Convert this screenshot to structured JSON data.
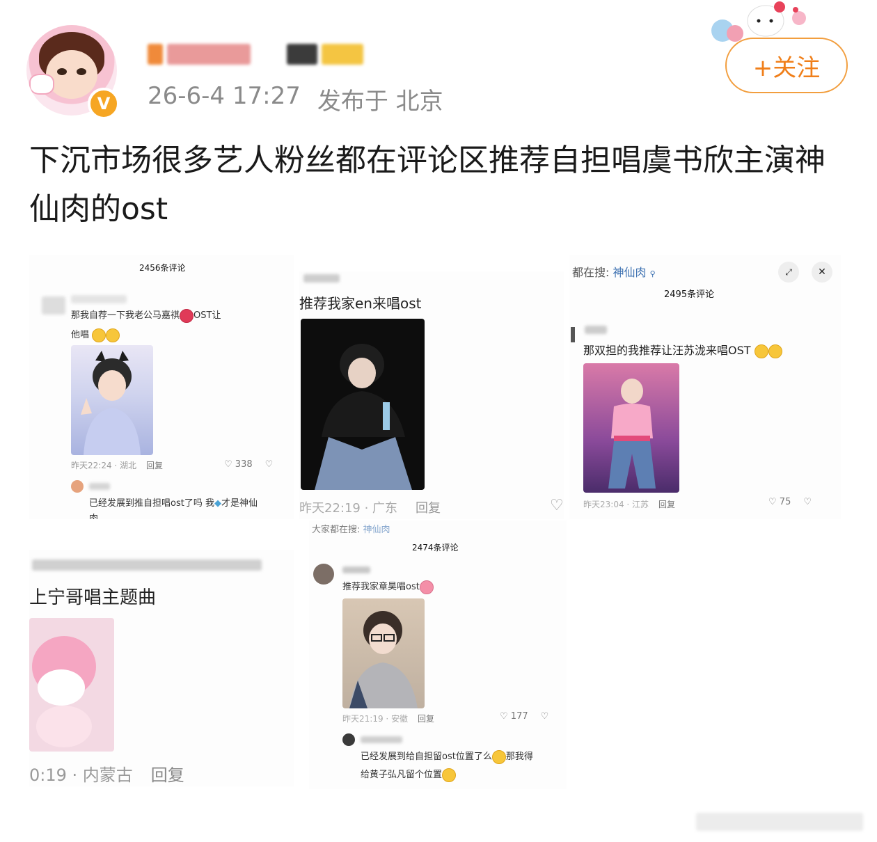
{
  "post": {
    "timestamp": "26-6-4 17:27",
    "location": "发布于 北京",
    "follow_label": "+关注",
    "text": "下沉市场很多艺人粉丝都在评论区推荐自担唱虞书欣主演神仙肉的ost"
  },
  "shots": {
    "a": {
      "count": "2456条评论",
      "comment": "那我自荐一下我老公马嘉祺",
      "comment_tail": "OST让",
      "comment_line2": "他唱",
      "time": "昨天22:24 · 湖北",
      "reply": "回复",
      "likes": "338",
      "sub_comment": "已经发展到推自担唱ost了吗  我",
      "sub_comment_tail": "才是神仙",
      "sub_comment_line2": "肉"
    },
    "b": {
      "comment": "推荐我家en来唱ost",
      "time": "昨天22:19 · 广东",
      "reply": "回复"
    },
    "c": {
      "search_prefix": "都在搜:",
      "search_term": "神仙肉",
      "count": "2495条评论",
      "comment": "那双担的我推荐让汪苏泷来唱OST",
      "time": "昨天23:04 · 江苏",
      "reply": "回复",
      "likes": "75"
    },
    "d": {
      "comment": "上宁哥唱主题曲",
      "time": "0:19 · 内蒙古",
      "reply": "回复"
    },
    "e": {
      "search_prefix": "大家都在搜:",
      "search_term": "神仙肉",
      "count": "2474条评论",
      "comment": "推荐我家章昊唱ost",
      "time": "昨天21:19 · 安徽",
      "reply": "回复",
      "likes": "177",
      "sub_comment": "已经发展到给自担留ost位置了么",
      "sub_comment_tail": "那我得",
      "sub_comment_line2": "给黄子弘凡留个位置"
    }
  }
}
